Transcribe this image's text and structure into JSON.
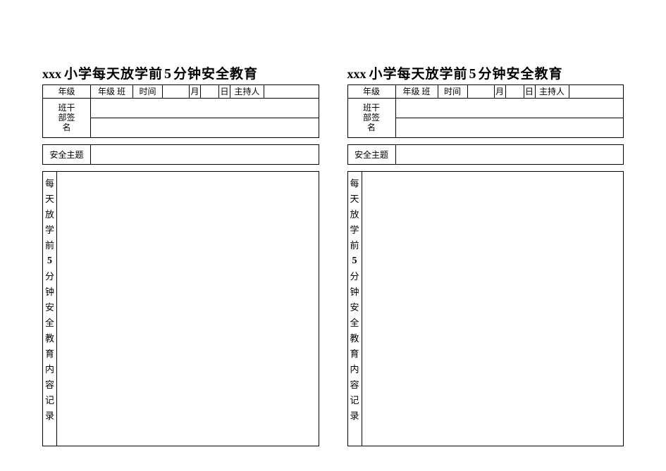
{
  "title": {
    "prefix": "xxx",
    "part1": "小学每天放学前",
    "number": "5",
    "part2": "分钟安全教育"
  },
  "header": {
    "grade_label": "年级",
    "grade_class_suffix": "年级  班",
    "time_label": "时间",
    "month_suffix": "月",
    "day_suffix": "日",
    "host_label": "主持人"
  },
  "signature_label": "班干部签名",
  "topic_label": "安全主题",
  "content_vertical": [
    "每",
    "天",
    "放",
    "学",
    "前",
    "5",
    "分",
    "钟",
    "安",
    "全",
    "教",
    "育",
    "内",
    "容",
    "记",
    "录"
  ],
  "fields": {
    "grade": "",
    "class": "",
    "month": "",
    "day": "",
    "host": "",
    "signatures_row1": "",
    "signatures_row2": "",
    "topic": "",
    "content": ""
  }
}
